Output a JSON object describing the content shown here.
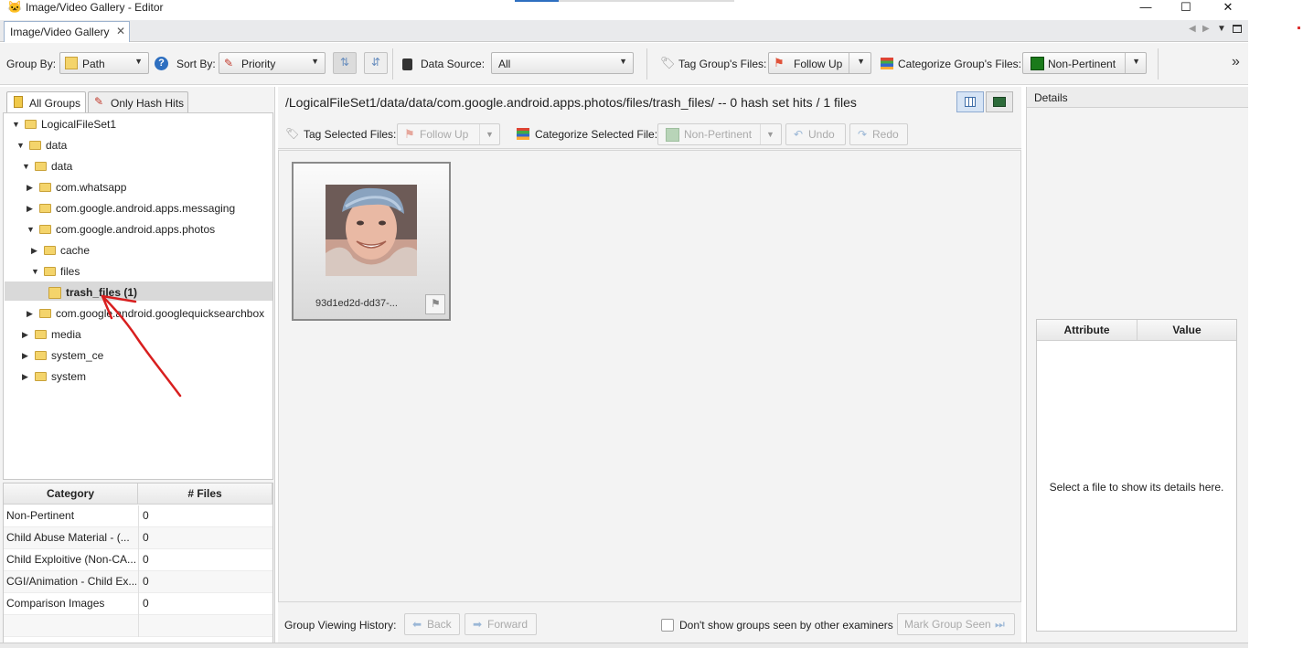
{
  "window": {
    "title": "Image/Video Gallery - Editor",
    "minimize": "—",
    "maximize": "☐",
    "close": "✕"
  },
  "tab": {
    "label": "Image/Video Gallery",
    "close": "✕"
  },
  "toolbar": {
    "group_by_label": "Group By:",
    "group_by_value": "Path",
    "sort_by_label": "Sort By:",
    "sort_by_value": "Priority",
    "data_source_label": "Data Source:",
    "data_source_value": "All",
    "tag_group_label": "Tag Group's Files:",
    "tag_group_value": "Follow Up",
    "categorize_group_label": "Categorize Group's Files:",
    "categorize_group_value": "Non-Pertinent",
    "overflow": "»"
  },
  "left_tabs": {
    "all_groups": "All Groups",
    "hash_hits": "Only Hash Hits"
  },
  "tree": [
    {
      "label": "LogicalFileSet1",
      "expanded": true
    },
    {
      "label": "data",
      "expanded": true
    },
    {
      "label": "data",
      "expanded": true
    },
    {
      "label": "com.whatsapp",
      "expanded": false
    },
    {
      "label": "com.google.android.apps.messaging",
      "expanded": false
    },
    {
      "label": "com.google.android.apps.photos",
      "expanded": true
    },
    {
      "label": "cache",
      "expanded": false
    },
    {
      "label": "files",
      "expanded": true
    },
    {
      "label": "trash_files (1)",
      "expanded": null
    },
    {
      "label": "com.google.android.googlequicksearchbox",
      "expanded": false
    },
    {
      "label": "media",
      "expanded": false
    },
    {
      "label": "system_ce",
      "expanded": false
    },
    {
      "label": "system",
      "expanded": false
    }
  ],
  "category_table": {
    "headers": [
      "Category",
      "# Files"
    ],
    "rows": [
      [
        "Non-Pertinent",
        "0"
      ],
      [
        "Child Abuse Material - (...",
        "0"
      ],
      [
        "Child Exploitive (Non-CA...",
        "0"
      ],
      [
        "CGI/Animation - Child Ex...",
        "0"
      ],
      [
        "Comparison Images",
        "0"
      ]
    ]
  },
  "center": {
    "group_path": "/LogicalFileSet1/data/data/com.google.android.apps.photos/files/trash_files/ -- 0 hash set hits / 1 files",
    "tag_selected_label": "Tag Selected Files:",
    "tag_selected_value": "Follow Up",
    "categorize_selected_label": "Categorize Selected File:",
    "categorize_selected_value": "Non-Pertinent",
    "undo": "Undo",
    "redo": "Redo",
    "thumbnail_name": "93d1ed2d-dd37-...",
    "history_label": "Group Viewing History:",
    "back": "Back",
    "forward": "Forward",
    "dont_show_label": "Don't show groups seen by other examiners",
    "mark_seen": "Mark Group Seen"
  },
  "details": {
    "title": "Details",
    "attr_header": "Attribute",
    "value_header": "Value",
    "placeholder": "Select a file to show its details here."
  },
  "colors": {
    "accent": "#2e6fc0",
    "follow_up_flag": "#e0523a",
    "non_pertinent": "#1a7a1a",
    "annotation": "#d81f1f"
  }
}
